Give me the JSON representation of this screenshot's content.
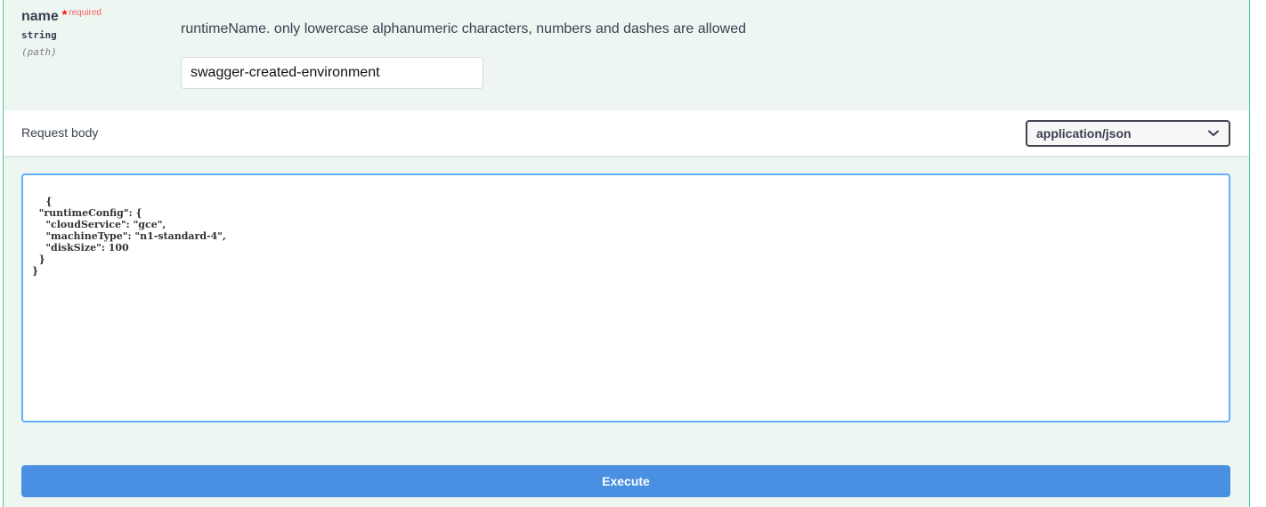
{
  "parameter": {
    "name": "name",
    "required_star": "*",
    "required_label": "required",
    "type": "string",
    "location": "(path)",
    "description": "runtimeName. only lowercase alphanumeric characters, numbers and dashes are allowed",
    "value": "swagger-created-environment"
  },
  "request_body": {
    "title": "Request body",
    "content_type": "application/json",
    "body": "{\n  \"runtimeConfig\": {\n    \"cloudService\": \"gce\",\n    \"machineType\": \"n1-standard-4\",\n    \"diskSize\": 100\n  }\n}"
  },
  "actions": {
    "execute_label": "Execute"
  },
  "colors": {
    "accent": "#49cc90",
    "panel_bg": "#edf6f1",
    "execute_bg": "#4990e2",
    "editor_border": "#61affe",
    "required": "#ff6060"
  },
  "icons": {
    "select_chevron": "chevron-down-icon",
    "resize": "resize-handle-icon"
  }
}
